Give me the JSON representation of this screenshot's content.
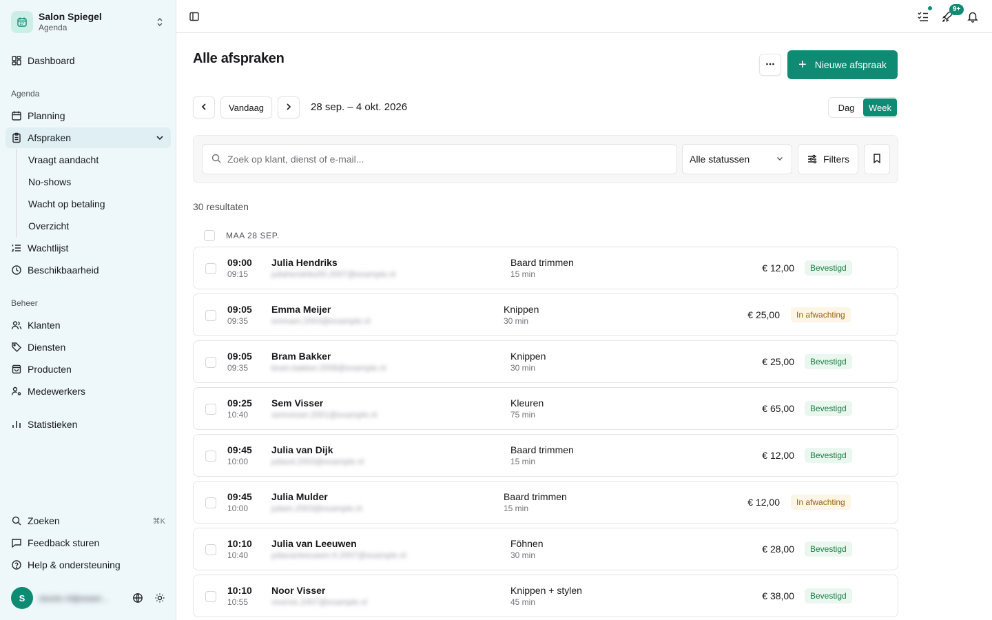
{
  "sidebar": {
    "brand_name": "Salon Spiegel",
    "brand_sub": "Agenda",
    "dashboard": "Dashboard",
    "group_agenda": "Agenda",
    "planning": "Planning",
    "afspraken": "Afspraken",
    "sub_items": [
      "Vraagt aandacht",
      "No-shows",
      "Wacht op betaling",
      "Overzicht"
    ],
    "wachtlijst": "Wachtlijst",
    "beschikbaarheid": "Beschikbaarheid",
    "group_beheer": "Beheer",
    "klanten": "Klanten",
    "diensten": "Diensten",
    "producten": "Producten",
    "medewerkers": "Medewerkers",
    "statistieken": "Statistieken",
    "zoeken": "Zoeken",
    "zoeken_kbd": "⌘K",
    "feedback": "Feedback sturen",
    "help": "Help & ondersteuning",
    "avatar_initial": "S",
    "user_email": "stoots-ridjewaer..."
  },
  "topbar": {
    "badge": "9+"
  },
  "main": {
    "title": "Alle afspraken",
    "new_button": "Nieuwe afspraak",
    "today": "Vandaag",
    "date_range": "28 sep. – 4 okt. 2026",
    "view_day": "Dag",
    "view_week": "Week",
    "search_placeholder": "Zoek op klant, dienst of e-mail...",
    "status_value": "Alle statussen",
    "filters": "Filters",
    "results": "30 resultaten",
    "day_label": "MAA 28 SEP."
  },
  "colors": {
    "accent": "#0f8a73",
    "sidebar_bg": "#eef8fb"
  },
  "appointments": [
    {
      "start": "09:00",
      "end": "09:15",
      "name": "Julia Hendriks",
      "email": "juliahendriks00.2007@example.nl",
      "service": "Baard trimmen",
      "duration": "15 min",
      "price": "€ 12,00",
      "status": "Bevestigd"
    },
    {
      "start": "09:05",
      "end": "09:35",
      "name": "Emma Meijer",
      "email": "emmam.2003@example.nl",
      "service": "Knippen",
      "duration": "30 min",
      "price": "€ 25,00",
      "status": "In afwachting"
    },
    {
      "start": "09:05",
      "end": "09:35",
      "name": "Bram Bakker",
      "email": "bram.bakker.2008@example.nl",
      "service": "Knippen",
      "duration": "30 min",
      "price": "€ 25,00",
      "status": "Bevestigd"
    },
    {
      "start": "09:25",
      "end": "10:40",
      "name": "Sem Visser",
      "email": "semvisser.2001@example.nl",
      "service": "Kleuren",
      "duration": "75 min",
      "price": "€ 65,00",
      "status": "Bevestigd"
    },
    {
      "start": "09:45",
      "end": "10:00",
      "name": "Julia van Dijk",
      "email": "juliavd.2003@example.nl",
      "service": "Baard trimmen",
      "duration": "15 min",
      "price": "€ 12,00",
      "status": "Bevestigd"
    },
    {
      "start": "09:45",
      "end": "10:00",
      "name": "Julia Mulder",
      "email": "juliam.2003@example.nl",
      "service": "Baard trimmen",
      "duration": "15 min",
      "price": "€ 12,00",
      "status": "In afwachting"
    },
    {
      "start": "10:10",
      "end": "10:40",
      "name": "Julia van Leeuwen",
      "email": "juliavanleeuwen.fr.2007@example.nl",
      "service": "Föhnen",
      "duration": "30 min",
      "price": "€ 28,00",
      "status": "Bevestigd"
    },
    {
      "start": "10:10",
      "end": "10:55",
      "name": "Noor Visser",
      "email": "noorvis.2007@example.nl",
      "service": "Knippen + stylen",
      "duration": "45 min",
      "price": "€ 38,00",
      "status": "Bevestigd"
    }
  ]
}
